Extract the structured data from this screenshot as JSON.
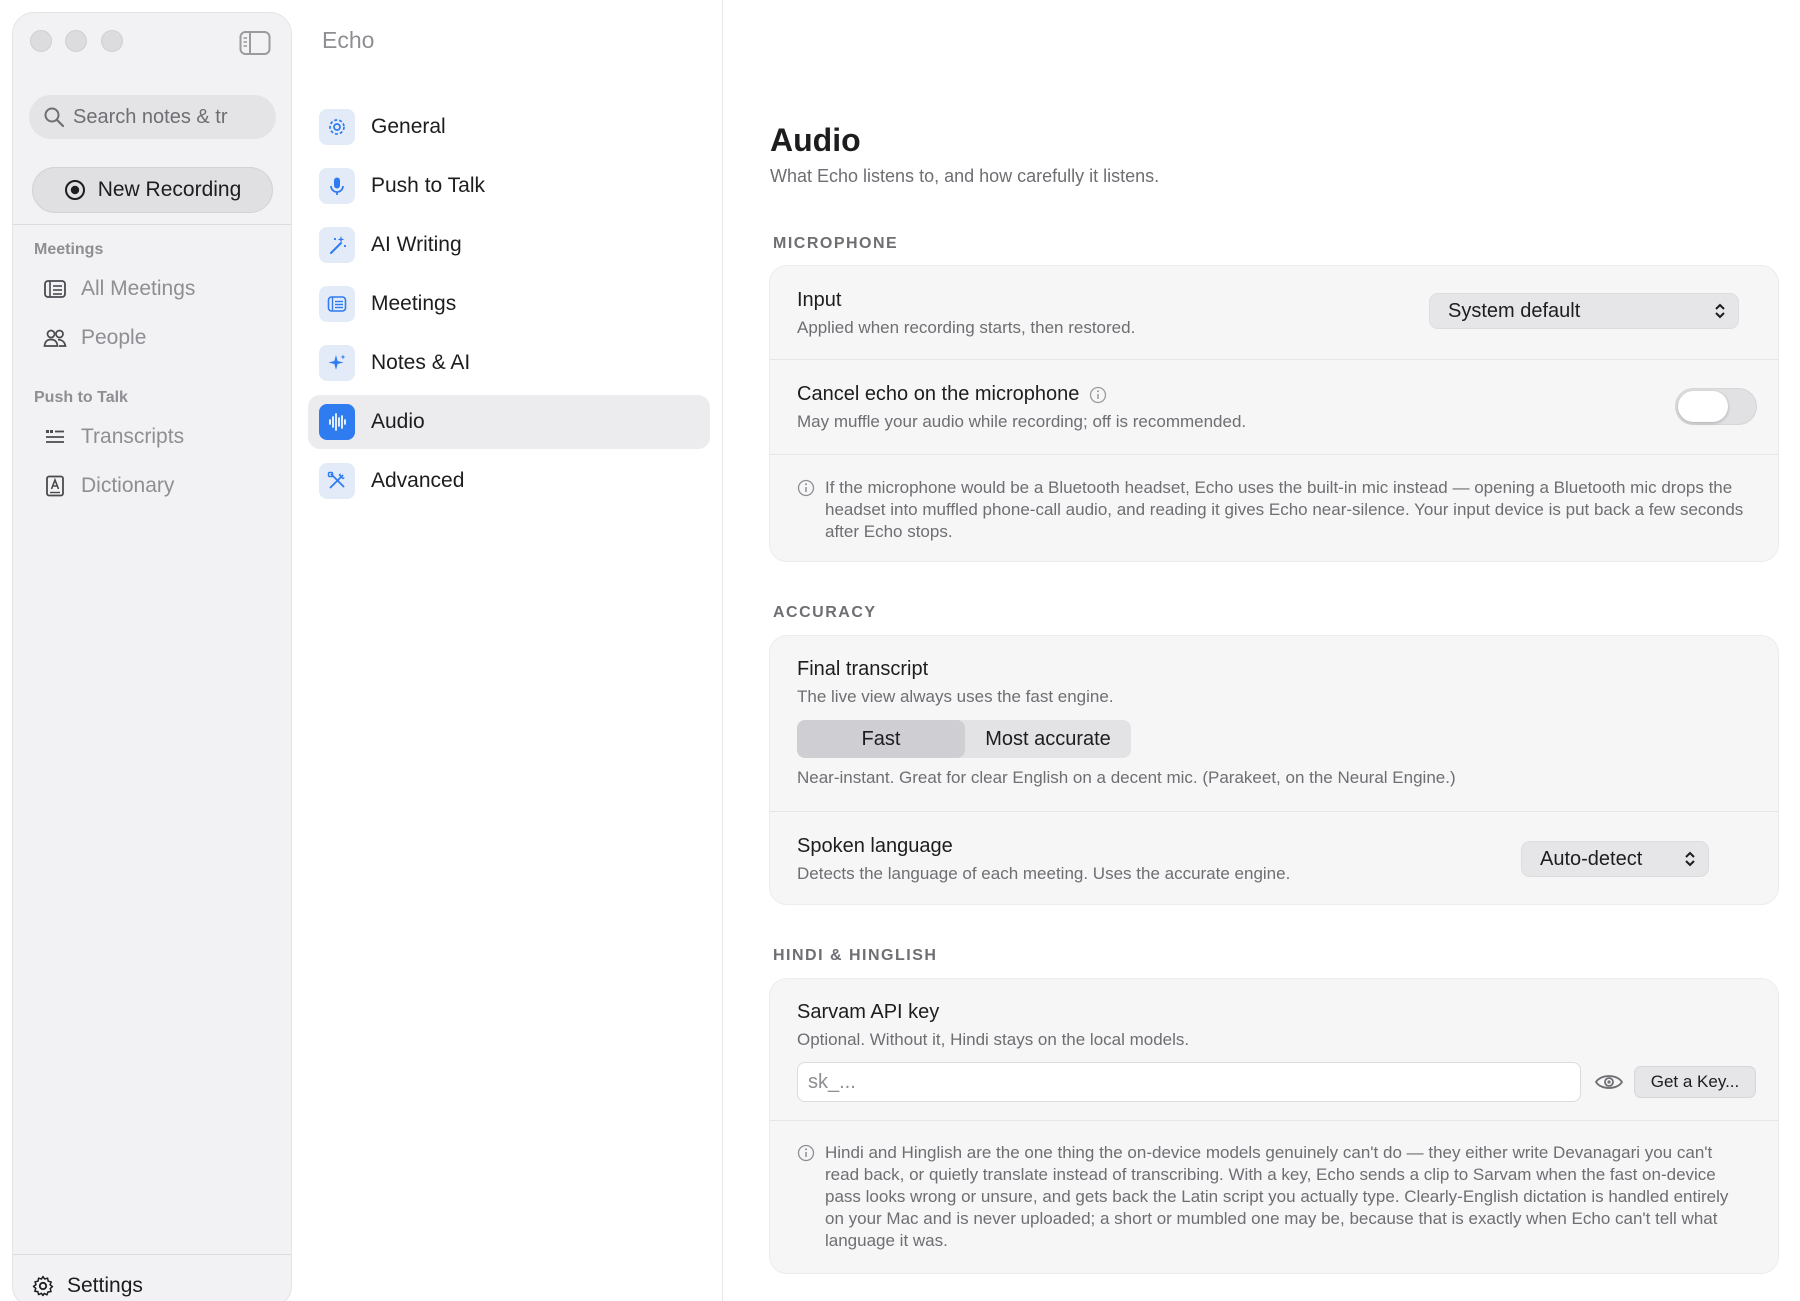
{
  "window": {
    "traffic_lights": [
      "close",
      "minimize",
      "zoom"
    ]
  },
  "sidebar": {
    "search_placeholder": "Search notes & tr",
    "new_recording_label": "New Recording",
    "sections": [
      {
        "title": "Meetings",
        "items": [
          {
            "label": "All Meetings",
            "icon": "list-icon"
          },
          {
            "label": "People",
            "icon": "people-icon"
          }
        ]
      },
      {
        "title": "Push to Talk",
        "items": [
          {
            "label": "Transcripts",
            "icon": "transcript-icon"
          },
          {
            "label": "Dictionary",
            "icon": "dictionary-icon"
          }
        ]
      }
    ],
    "settings_label": "Settings"
  },
  "settings_nav": {
    "app_title": "Echo",
    "items": [
      {
        "label": "General",
        "icon": "gear-icon"
      },
      {
        "label": "Push to Talk",
        "icon": "microphone-icon"
      },
      {
        "label": "AI Writing",
        "icon": "wand-icon"
      },
      {
        "label": "Meetings",
        "icon": "list-icon"
      },
      {
        "label": "Notes & AI",
        "icon": "sparkle-icon"
      },
      {
        "label": "Audio",
        "icon": "waveform-icon",
        "active": true
      },
      {
        "label": "Advanced",
        "icon": "tools-icon"
      }
    ],
    "accent": "#2f7bf0"
  },
  "main": {
    "title": "Audio",
    "subtitle": "What Echo listens to, and how carefully it listens.",
    "microphone": {
      "heading": "MICROPHONE",
      "input_label": "Input",
      "input_desc": "Applied when recording starts, then restored.",
      "input_value": "System default",
      "echo_label": "Cancel echo on the microphone",
      "echo_desc": "May muffle your audio while recording; off is recommended.",
      "echo_enabled": false,
      "note": "If the microphone would be a Bluetooth headset, Echo uses the built-in mic instead — opening a Bluetooth mic drops the headset into muffled phone-call audio, and reading it gives Echo near-silence. Your input device is put back a few seconds after Echo stops."
    },
    "accuracy": {
      "heading": "ACCURACY",
      "final_label": "Final transcript",
      "final_desc": "The live view always uses the fast engine.",
      "options": [
        "Fast",
        "Most accurate"
      ],
      "selected": "Fast",
      "mode_desc": "Near-instant. Great for clear English on a decent mic. (Parakeet, on the Neural Engine.)",
      "lang_label": "Spoken language",
      "lang_desc": "Detects the language of each meeting. Uses the accurate engine.",
      "lang_value": "Auto-detect"
    },
    "hindi": {
      "heading": "HINDI & HINGLISH",
      "key_label": "Sarvam API key",
      "key_desc": "Optional. Without it, Hindi stays on the local models.",
      "key_placeholder": "sk_...",
      "get_key_label": "Get a Key...",
      "note": "Hindi and Hinglish are the one thing the on-device models genuinely can't do — they either write Devanagari you can't read back, or quietly translate instead of transcribing. With a key, Echo sends a clip to Sarvam when the fast on-device pass looks wrong or unsure, and gets back the Latin script you actually type. Clearly-English dictation is handled entirely on your Mac and is never uploaded; a short or mumbled one may be, because that is exactly when Echo can't tell what language it was."
    }
  }
}
